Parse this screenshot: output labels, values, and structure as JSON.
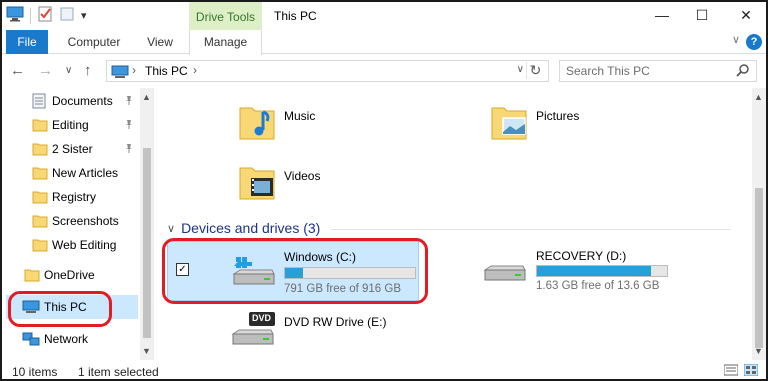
{
  "titlebar": {
    "context_tab": "Drive Tools",
    "title": "This PC",
    "minimize_glyph": "—",
    "maximize_glyph": "☐",
    "close_glyph": "✕",
    "qat_dropdown_glyph": "▾"
  },
  "ribbon": {
    "tabs": [
      "File",
      "Computer",
      "View",
      "Manage"
    ],
    "help_glyph": "?",
    "collapse_glyph": "∨"
  },
  "address": {
    "back_glyph": "←",
    "forward_glyph": "→",
    "recent_glyph": "∨",
    "up_glyph": "↑",
    "crumb": "This PC",
    "crumb_sep": "›",
    "dropdown_glyph": "∨",
    "refresh_glyph": "↻",
    "search_placeholder": "Search This PC"
  },
  "nav": {
    "pinned": [
      {
        "label": "Documents",
        "icon": "documents-icon",
        "pinned": true
      },
      {
        "label": "Editing",
        "icon": "folder-icon",
        "pinned": true
      },
      {
        "label": "2 Sister",
        "icon": "folder-icon",
        "pinned": true
      },
      {
        "label": "New Articles",
        "icon": "folder-icon",
        "pinned": false
      },
      {
        "label": "Registry",
        "icon": "folder-icon",
        "pinned": false
      },
      {
        "label": "Screenshots",
        "icon": "folder-icon",
        "pinned": false
      },
      {
        "label": "Web Editing",
        "icon": "folder-icon",
        "pinned": false
      }
    ],
    "onedrive": "OneDrive",
    "thispc": "This PC",
    "network": "Network",
    "pin_glyph": "📌"
  },
  "folders": [
    {
      "label": "Music",
      "icon": "music-folder-icon"
    },
    {
      "label": "Pictures",
      "icon": "pictures-folder-icon"
    },
    {
      "label": "Videos",
      "icon": "videos-folder-icon"
    }
  ],
  "group": {
    "label": "Devices and drives (3)",
    "chevron": "∨"
  },
  "drives": [
    {
      "name": "Windows (C:)",
      "free_text": "791 GB free of 916 GB",
      "used_fraction": 0.136,
      "checked": true,
      "check_glyph": "✓"
    },
    {
      "name": "RECOVERY (D:)",
      "free_text": "1.63 GB free of 13.6 GB",
      "used_fraction": 0.88
    }
  ],
  "dvd": {
    "name": "DVD RW Drive (E:)",
    "badge": "DVD"
  },
  "status": {
    "items": "10 items",
    "selected": "1 item selected"
  },
  "colors": {
    "accent": "#1979ca",
    "selection": "#cce8ff",
    "drive_bar": "#26a0da",
    "highlight_ring": "#e31b23",
    "context_tab_bg": "#dcefc7"
  }
}
